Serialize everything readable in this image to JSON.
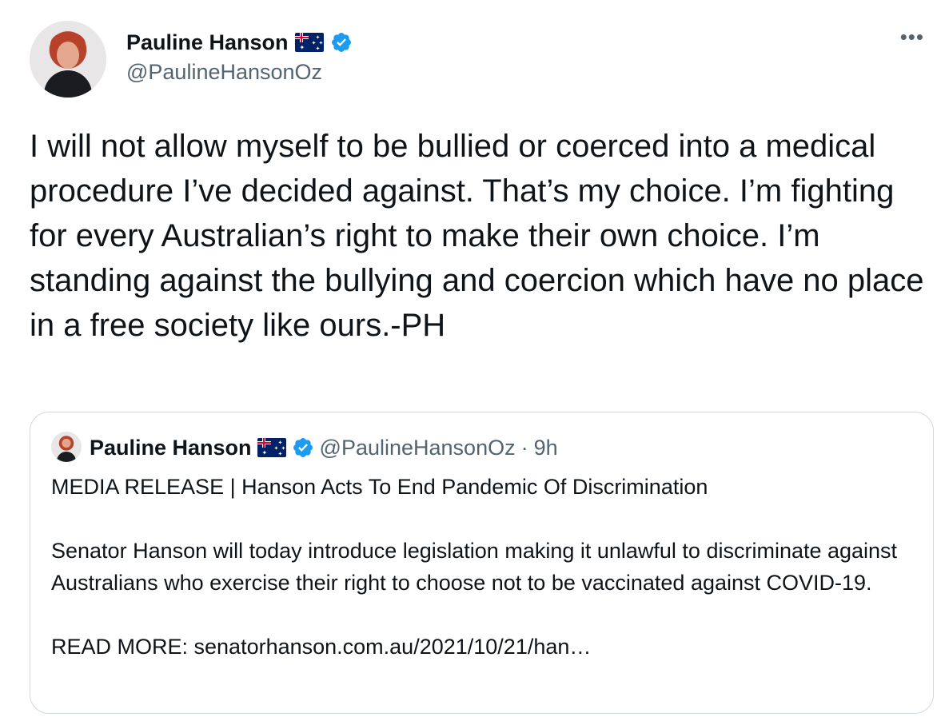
{
  "author": {
    "display_name": "Pauline Hanson",
    "handle": "@PaulineHansonOz",
    "flag_icon": "australia-flag-icon",
    "verified_icon": "verified-badge-icon",
    "verified_color": "#1d9bf0"
  },
  "more_label": "•••",
  "tweet_text": "I will not allow myself to be bullied or coerced into a medical procedure I’ve decided against. That’s my choice. I’m fighting for every Australian’s right to make their own choice. I’m standing against the bullying and coercion which have no place in a free society like ours.-PH",
  "quoted": {
    "display_name": "Pauline Hanson",
    "handle": "@PaulineHansonOz",
    "separator": "·",
    "time": "9h",
    "text": "MEDIA RELEASE | Hanson Acts To End Pandemic Of Discrimination\n\nSenator Hanson will today introduce legislation making it unlawful to discriminate against Australians who exercise their right to choose not to be vaccinated against COVID-19.\n\nREAD MORE: senatorhanson.com.au/2021/10/21/han…"
  },
  "colors": {
    "text": "#0f1419",
    "secondary": "#536471",
    "border": "#cfd9de"
  }
}
